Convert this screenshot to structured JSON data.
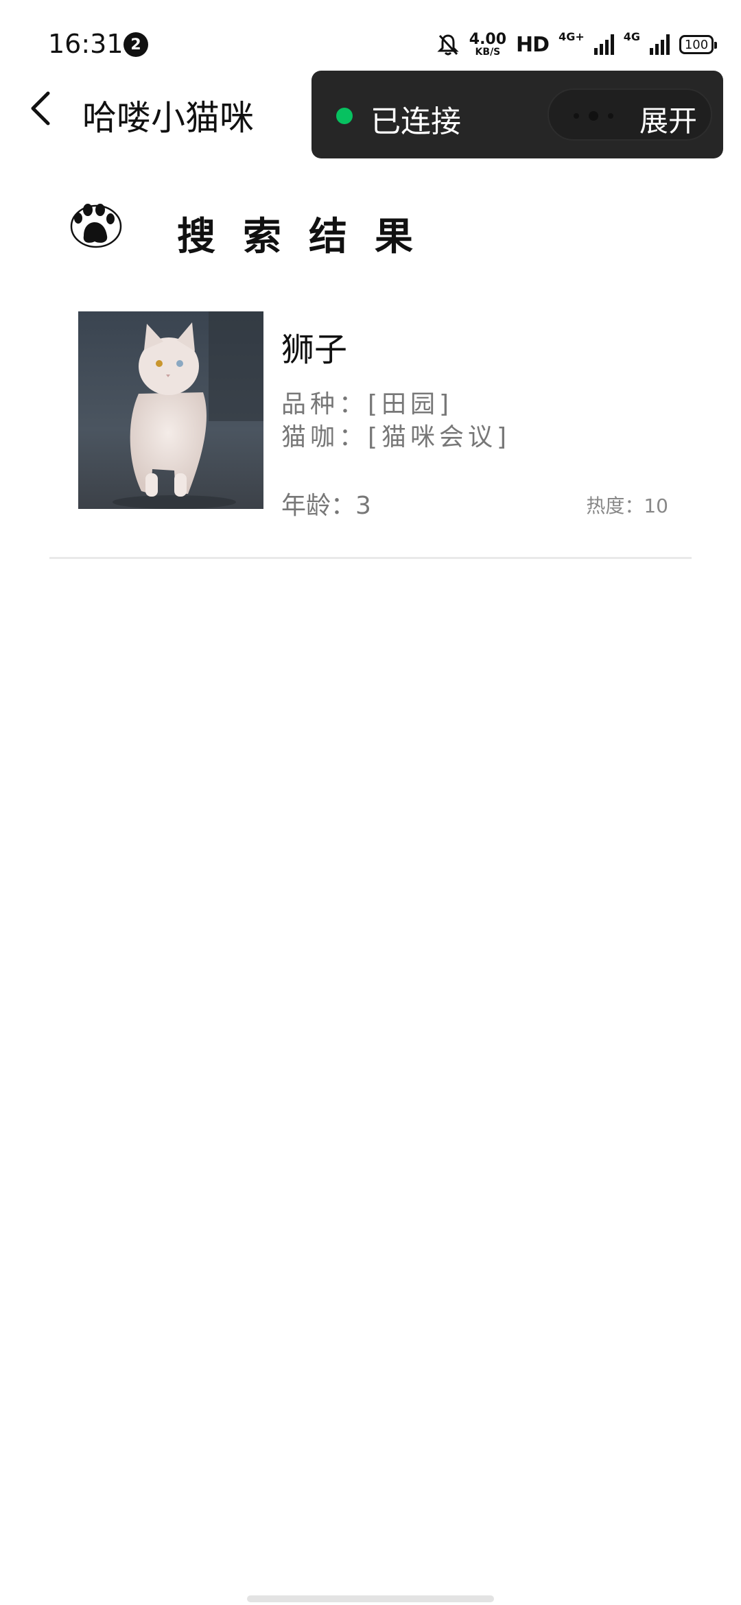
{
  "status_bar": {
    "time": "16:31",
    "notification_count": "2",
    "net_speed_value": "4.00",
    "net_speed_unit": "KB/S",
    "hd_label": "HD",
    "signal1_label": "4G+",
    "signal2_label": "4G",
    "battery": "100"
  },
  "nav": {
    "title": "哈喽小猫咪"
  },
  "connection": {
    "status": "已连接",
    "expand_label": "展开",
    "dot_color": "#07c160"
  },
  "section": {
    "title": "搜索结果"
  },
  "results": [
    {
      "name": "狮子",
      "breed": "品种：[田园]",
      "cafe": "猫咖：[猫咪会议]",
      "age": "年龄：3",
      "heat": "热度：10"
    }
  ]
}
